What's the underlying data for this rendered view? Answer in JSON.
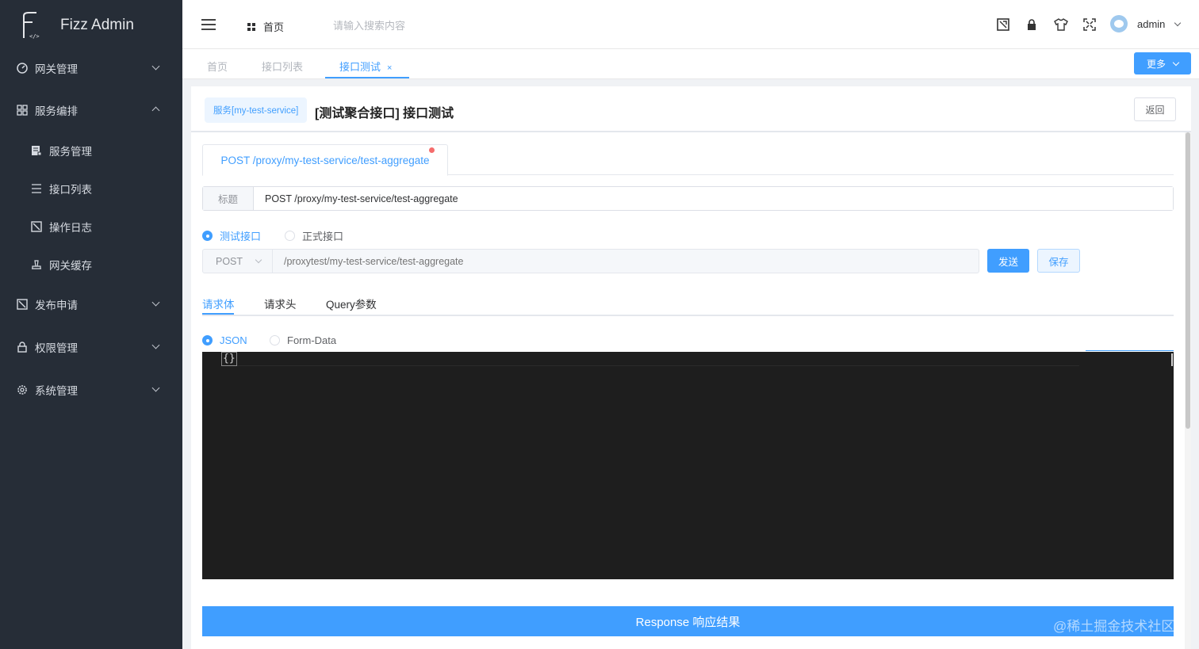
{
  "app": {
    "title": "Fizz Admin"
  },
  "sidebar": {
    "items": [
      {
        "label": "网关管理",
        "icon": "gauge-icon",
        "expanded": false
      },
      {
        "label": "服务编排",
        "icon": "grid-icon",
        "expanded": true
      },
      {
        "label": "服务管理",
        "icon": "document-icon"
      },
      {
        "label": "接口列表",
        "icon": "list-icon"
      },
      {
        "label": "操作日志",
        "icon": "log-icon"
      },
      {
        "label": "网关缓存",
        "icon": "cache-icon"
      },
      {
        "label": "发布申请",
        "icon": "publish-icon",
        "expanded": false
      },
      {
        "label": "权限管理",
        "icon": "lock-icon",
        "expanded": false
      },
      {
        "label": "系统管理",
        "icon": "gear-icon",
        "expanded": false
      }
    ]
  },
  "header": {
    "home_label": "首页",
    "search_placeholder": "请输入搜索内容",
    "username": "admin",
    "icons": [
      "screenshot-icon",
      "lock-icon",
      "theme-shirt-icon",
      "fullscreen-icon"
    ]
  },
  "tags": {
    "items": [
      "首页",
      "接口列表",
      "接口测试"
    ],
    "active_index": 2,
    "close_glyph": "×",
    "more_label": "更多"
  },
  "page": {
    "service_badge": "服务[my-test-service]",
    "title": "[测试聚合接口] 接口测试",
    "back_label": "返回",
    "api_tab": "POST /proxy/my-test-service/test-aggregate",
    "title_label": "标题",
    "title_value": "POST /proxy/my-test-service/test-aggregate",
    "env_options": [
      "测试接口",
      "正式接口"
    ],
    "env_selected": "测试接口",
    "method": "POST",
    "url_placeholder": "/proxytest/my-test-service/test-aggregate",
    "send_label": "发送",
    "save_label": "保存",
    "request_tabs": [
      "请求体",
      "请求头",
      "Query参数"
    ],
    "request_tab_active": "请求体",
    "body_types": [
      "JSON",
      "Form-Data"
    ],
    "body_type_selected": "JSON",
    "editor_content": "{}",
    "response_label": "Response 响应结果"
  },
  "watermark": "@稀土掘金技术社区",
  "colors": {
    "accent": "#409eff",
    "sidebar_bg": "#262d37",
    "editor_bg": "#1e1e1e",
    "dot": "#f56c6c"
  }
}
